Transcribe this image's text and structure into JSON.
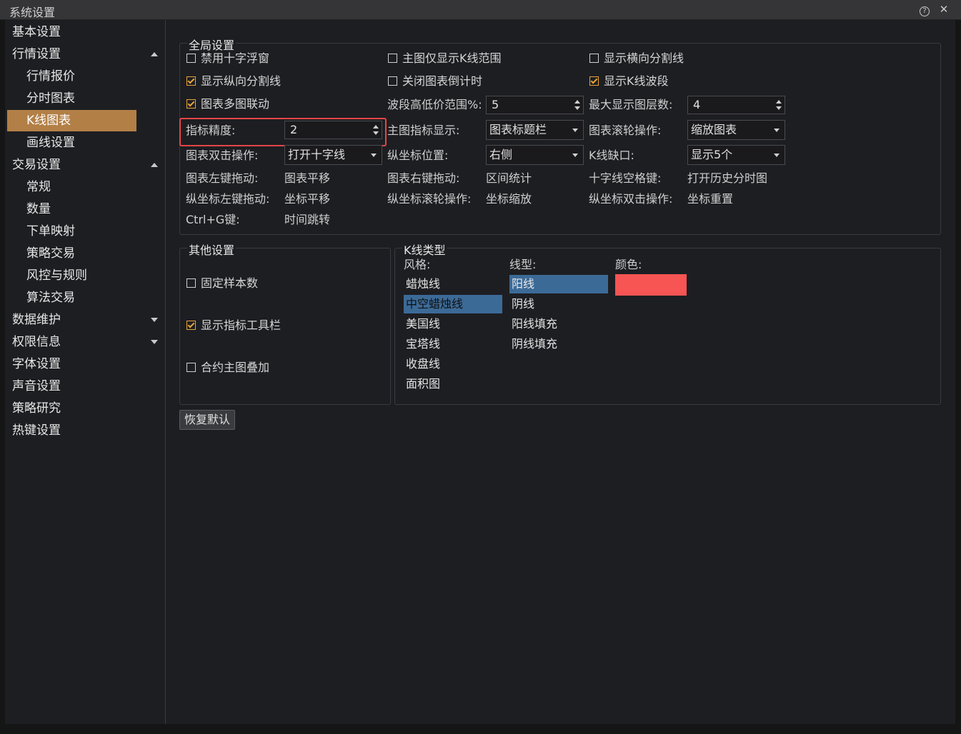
{
  "window": {
    "title": "系统设置"
  },
  "sidebar": {
    "items": [
      {
        "label": "基本设置",
        "level": 1,
        "arrow": ""
      },
      {
        "label": "行情设置",
        "level": 1,
        "arrow": "up"
      },
      {
        "label": "行情报价",
        "level": 2,
        "arrow": ""
      },
      {
        "label": "分时图表",
        "level": 2,
        "arrow": ""
      },
      {
        "label": "K线图表",
        "level": 2,
        "arrow": "",
        "selected": true
      },
      {
        "label": "画线设置",
        "level": 2,
        "arrow": ""
      },
      {
        "label": "交易设置",
        "level": 1,
        "arrow": "up"
      },
      {
        "label": "常规",
        "level": 2,
        "arrow": ""
      },
      {
        "label": "数量",
        "level": 2,
        "arrow": ""
      },
      {
        "label": "下单映射",
        "level": 2,
        "arrow": ""
      },
      {
        "label": "策略交易",
        "level": 2,
        "arrow": ""
      },
      {
        "label": "风控与规则",
        "level": 2,
        "arrow": ""
      },
      {
        "label": "算法交易",
        "level": 2,
        "arrow": ""
      },
      {
        "label": "数据维护",
        "level": 1,
        "arrow": "down"
      },
      {
        "label": "权限信息",
        "level": 1,
        "arrow": "down"
      },
      {
        "label": "字体设置",
        "level": 1,
        "arrow": ""
      },
      {
        "label": "声音设置",
        "level": 1,
        "arrow": ""
      },
      {
        "label": "策略研究",
        "level": 1,
        "arrow": ""
      },
      {
        "label": "热键设置",
        "level": 1,
        "arrow": ""
      }
    ]
  },
  "global": {
    "title": "全局设置",
    "checks": {
      "disable_crosshair": {
        "label": "禁用十字浮窗",
        "checked": false
      },
      "main_kline_range": {
        "label": "主图仅显示K线范围",
        "checked": false
      },
      "show_h_divider": {
        "label": "显示横向分割线",
        "checked": false
      },
      "show_v_divider": {
        "label": "显示纵向分割线",
        "checked": true
      },
      "close_countdown": {
        "label": "关闭图表倒计时",
        "checked": false
      },
      "show_kline_wave": {
        "label": "显示K线波段",
        "checked": true
      },
      "chart_link": {
        "label": "图表多图联动",
        "checked": true
      }
    },
    "wave_range": {
      "label": "波段高低价范围%:",
      "value": "5"
    },
    "max_layers": {
      "label": "最大显示图层数:",
      "value": "4"
    },
    "indicator_precision": {
      "label": "指标精度:",
      "value": "2"
    },
    "main_indicator_display": {
      "label": "主图指标显示:",
      "value": "图表标题栏"
    },
    "wheel_action": {
      "label": "图表滚轮操作:",
      "value": "缩放图表"
    },
    "double_click": {
      "label": "图表双击操作:",
      "value": "打开十字线"
    },
    "y_axis_position": {
      "label": "纵坐标位置:",
      "value": "右侧"
    },
    "kline_gap": {
      "label": "K线缺口:",
      "value": "显示5个"
    },
    "static_rows": [
      {
        "l1": "图表左键拖动:",
        "v1": "图表平移",
        "l2": "图表右键拖动:",
        "v2": "区间统计",
        "l3": "十字线空格键:",
        "v3": "打开历史分时图"
      },
      {
        "l1": "纵坐标左键拖动:",
        "v1": "坐标平移",
        "l2": "纵坐标滚轮操作:",
        "v2": "坐标缩放",
        "l3": "纵坐标双击操作:",
        "v3": "坐标重置"
      },
      {
        "l1": "Ctrl+G键:",
        "v1": "时间跳转"
      }
    ]
  },
  "other": {
    "title": "其他设置",
    "fixed_samples": {
      "label": "固定样本数",
      "checked": false
    },
    "show_indicator_toolbar": {
      "label": "显示指标工具栏",
      "checked": true
    },
    "contract_overlay": {
      "label": "合约主图叠加",
      "checked": false
    }
  },
  "kline_type": {
    "title": "K线类型",
    "style_label": "风格:",
    "line_label": "线型:",
    "color_label": "颜色:",
    "styles": [
      "蜡烛线",
      "中空蜡烛线",
      "美国线",
      "宝塔线",
      "收盘线",
      "面积图"
    ],
    "selected_style": "中空蜡烛线",
    "lines": [
      "阳线",
      "阴线",
      "阳线填充",
      "阴线填充"
    ],
    "selected_line": "阳线",
    "color": "#f75454"
  },
  "buttons": {
    "restore_default": "恢复默认"
  },
  "icons": {
    "help": "help-icon",
    "close": "close-icon"
  }
}
